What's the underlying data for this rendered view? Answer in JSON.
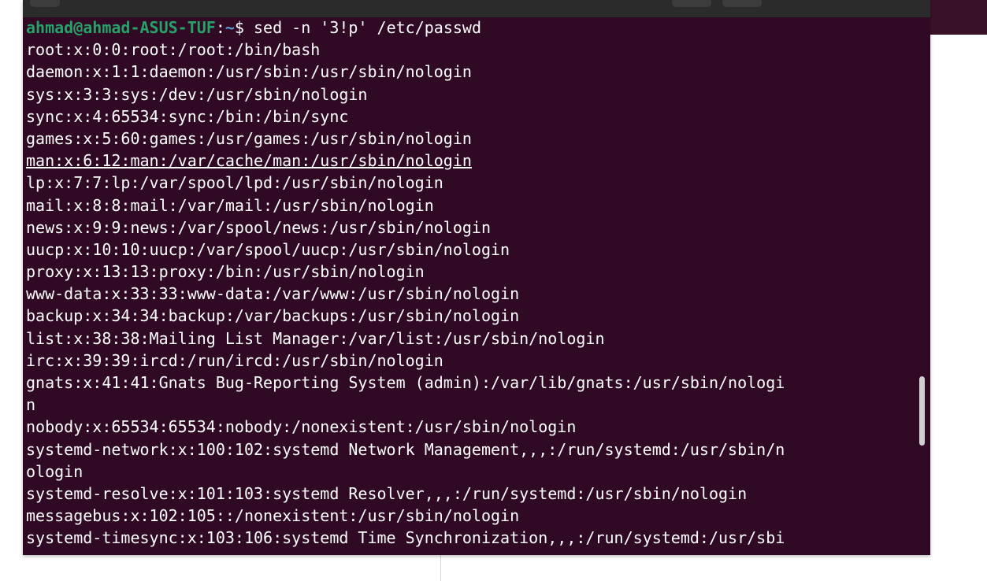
{
  "terminal": {
    "prompt": {
      "user_host": "ahmad@ahmad-ASUS-TUF",
      "separator": ":",
      "path": "~",
      "symbol": "$",
      "command": " sed -n '3!p' /etc/passwd"
    },
    "output_lines": [
      "root:x:0:0:root:/root:/bin/bash",
      "daemon:x:1:1:daemon:/usr/sbin:/usr/sbin/nologin",
      "sys:x:3:3:sys:/dev:/usr/sbin/nologin",
      "sync:x:4:65534:sync:/bin:/bin/sync",
      "games:x:5:60:games:/usr/games:/usr/sbin/nologin",
      "man:x:6:12:man:/var/cache/man:/usr/sbin/nologin",
      "lp:x:7:7:lp:/var/spool/lpd:/usr/sbin/nologin",
      "mail:x:8:8:mail:/var/mail:/usr/sbin/nologin",
      "news:x:9:9:news:/var/spool/news:/usr/sbin/nologin",
      "uucp:x:10:10:uucp:/var/spool/uucp:/usr/sbin/nologin",
      "proxy:x:13:13:proxy:/bin:/usr/sbin/nologin",
      "www-data:x:33:33:www-data:/var/www:/usr/sbin/nologin",
      "backup:x:34:34:backup:/var/backups:/usr/sbin/nologin",
      "list:x:38:38:Mailing List Manager:/var/list:/usr/sbin/nologin",
      "irc:x:39:39:ircd:/run/ircd:/usr/sbin/nologin",
      "gnats:x:41:41:Gnats Bug-Reporting System (admin):/var/lib/gnats:/usr/sbin/nologi",
      "n",
      "nobody:x:65534:65534:nobody:/nonexistent:/usr/sbin/nologin",
      "systemd-network:x:100:102:systemd Network Management,,,:/run/systemd:/usr/sbin/n",
      "ologin",
      "systemd-resolve:x:101:103:systemd Resolver,,,:/run/systemd:/usr/sbin/nologin",
      "messagebus:x:102:105::/nonexistent:/usr/sbin/nologin",
      "systemd-timesync:x:103:106:systemd Time Synchronization,,,:/run/systemd:/usr/sbi"
    ],
    "underlined_line_index": 5
  },
  "colors": {
    "terminal_background": "#300a24",
    "prompt_user_host": "#26a269",
    "prompt_path": "#5a9bd8",
    "text": "#ffffff"
  }
}
